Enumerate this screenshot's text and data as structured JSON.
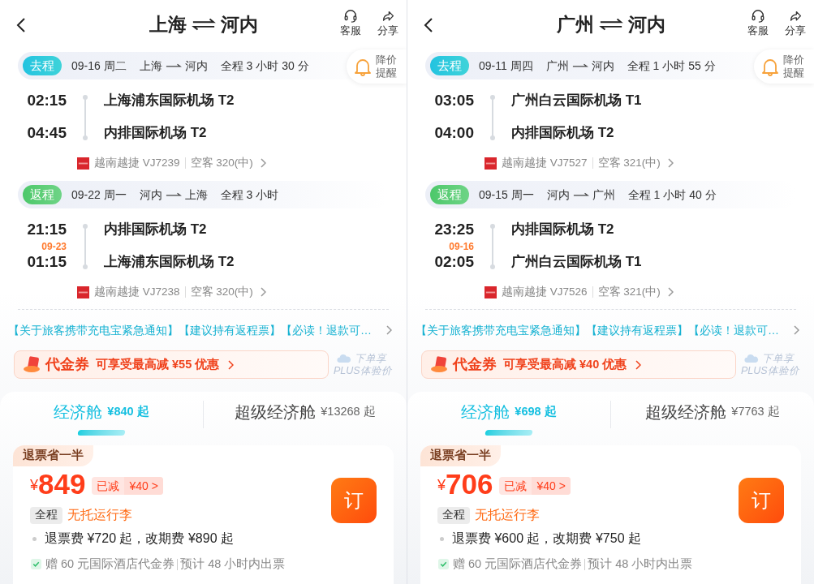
{
  "panels": [
    {
      "title": {
        "from": "上海",
        "to": "河内"
      },
      "header_actions": [
        {
          "kind": "service",
          "label": "客服"
        },
        {
          "kind": "share",
          "label": "分享"
        }
      ],
      "price_alert": {
        "line1": "降价",
        "line2": "提醒"
      },
      "legs": [
        {
          "kind": "outbound",
          "tag": "去程",
          "date": "09-16 周二",
          "route_from": "上海",
          "route_to": "河内",
          "duration": "全程 3 小时 30 分",
          "depart_time": "02:15",
          "depart_airport": "上海浦东国际机场 T2",
          "arrive_time": "04:45",
          "arrive_airport": "内排国际机场 T2",
          "airline": "越南越捷 VJ7239",
          "aircraft": "空客 320(中)"
        },
        {
          "kind": "return",
          "tag": "返程",
          "date": "09-22 周一",
          "route_from": "河内",
          "route_to": "上海",
          "duration": "全程 3 小时",
          "depart_time": "21:15",
          "depart_airport": "内排国际机场 T2",
          "arrive_note": "09-23",
          "arrive_time": "01:15",
          "arrive_airport": "上海浦东国际机场 T2",
          "airline": "越南越捷 VJ7238",
          "aircraft": "空客 320(中)"
        }
      ],
      "notice": "【关于旅客携带充电宝紧急通知】【建议持有返程票】【必读！退款可…",
      "coupon": {
        "title": "代金券",
        "text": "可享受最高减 ¥55 优惠"
      },
      "plus": {
        "line1": "下单享",
        "line2": "PLUS体验价"
      },
      "cabin_tabs": [
        {
          "name": "经济舱",
          "price": "¥840 起",
          "selected": true
        },
        {
          "name": "超级经济舱",
          "price": "¥13268 起",
          "selected": false
        }
      ],
      "fare": {
        "tag": "退票省一半",
        "currency": "¥",
        "price": "849",
        "discount_label": "已减",
        "discount": "¥40 >",
        "trip_tag": "全程",
        "baggage": "无托运行李",
        "fees": "退票费 ¥720 起，改期费 ¥890 起",
        "perks": [
          "赠 60 元国际酒店代金券",
          "预计 48 小时内出票"
        ],
        "book": "订"
      }
    },
    {
      "title": {
        "from": "广州",
        "to": "河内"
      },
      "header_actions": [
        {
          "kind": "service",
          "label": "客服"
        },
        {
          "kind": "share",
          "label": "分享"
        }
      ],
      "price_alert": {
        "line1": "降价",
        "line2": "提醒"
      },
      "legs": [
        {
          "kind": "outbound",
          "tag": "去程",
          "date": "09-11 周四",
          "route_from": "广州",
          "route_to": "河内",
          "duration": "全程 1 小时 55 分",
          "depart_time": "03:05",
          "depart_airport": "广州白云国际机场 T1",
          "arrive_time": "04:00",
          "arrive_airport": "内排国际机场 T2",
          "airline": "越南越捷 VJ7527",
          "aircraft": "空客 321(中)"
        },
        {
          "kind": "return",
          "tag": "返程",
          "date": "09-15 周一",
          "route_from": "河内",
          "route_to": "广州",
          "duration": "全程 1 小时 40 分",
          "depart_time": "23:25",
          "depart_airport": "内排国际机场 T2",
          "arrive_note": "09-16",
          "arrive_time": "02:05",
          "arrive_airport": "广州白云国际机场 T1",
          "airline": "越南越捷 VJ7526",
          "aircraft": "空客 321(中)"
        }
      ],
      "notice": "【关于旅客携带充电宝紧急通知】【建议持有返程票】【必读！退款可…",
      "coupon": {
        "title": "代金券",
        "text": "可享受最高减 ¥40 优惠"
      },
      "plus": {
        "line1": "下单享",
        "line2": "PLUS体验价"
      },
      "cabin_tabs": [
        {
          "name": "经济舱",
          "price": "¥698 起",
          "selected": true
        },
        {
          "name": "超级经济舱",
          "price": "¥7763 起",
          "selected": false
        }
      ],
      "fare": {
        "tag": "退票省一半",
        "currency": "¥",
        "price": "706",
        "discount_label": "已减",
        "discount": "¥40 >",
        "trip_tag": "全程",
        "baggage": "无托运行李",
        "fees": "退票费 ¥600 起，改期费 ¥750 起",
        "perks": [
          "赠 60 元国际酒店代金券",
          "预计 48 小时内出票"
        ],
        "book": "订"
      }
    }
  ]
}
